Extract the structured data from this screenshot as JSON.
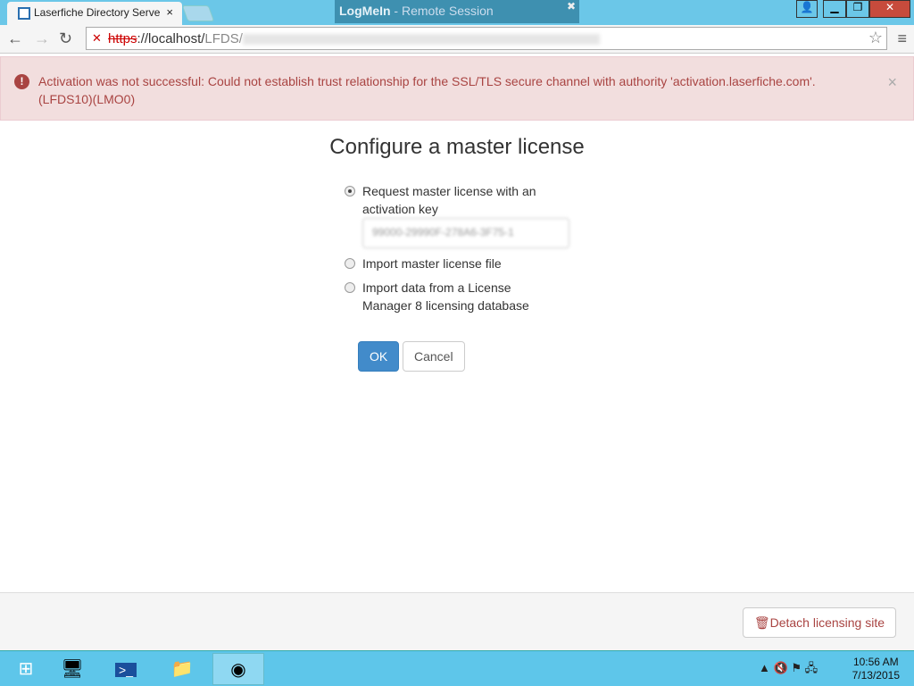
{
  "browser": {
    "tab_title": "Laserfiche Directory Serve",
    "url_scheme": "https",
    "url_host": "://localhost/",
    "url_path": "LFDS/",
    "logmein_brand": "LogMeIn",
    "logmein_sep": " - ",
    "logmein_label": "Remote Session"
  },
  "alert": {
    "message": "Activation was not successful: Could not establish trust relationship for the SSL/TLS secure channel with authority 'activation.laserfiche.com'. (LFDS10)(LMO0)"
  },
  "page": {
    "title": "Configure a master license",
    "options": [
      {
        "label": "Request master license with an activation key",
        "selected": true
      },
      {
        "label": "Import master license file",
        "selected": false
      },
      {
        "label": "Import data from a License Manager 8 licensing database",
        "selected": false
      }
    ],
    "activation_key": "99000-29990F-278A6-3F75-1",
    "ok": "OK",
    "cancel": "Cancel",
    "detach": "Detach licensing site"
  },
  "taskbar": {
    "time": "10:56 AM",
    "date": "7/13/2015"
  }
}
